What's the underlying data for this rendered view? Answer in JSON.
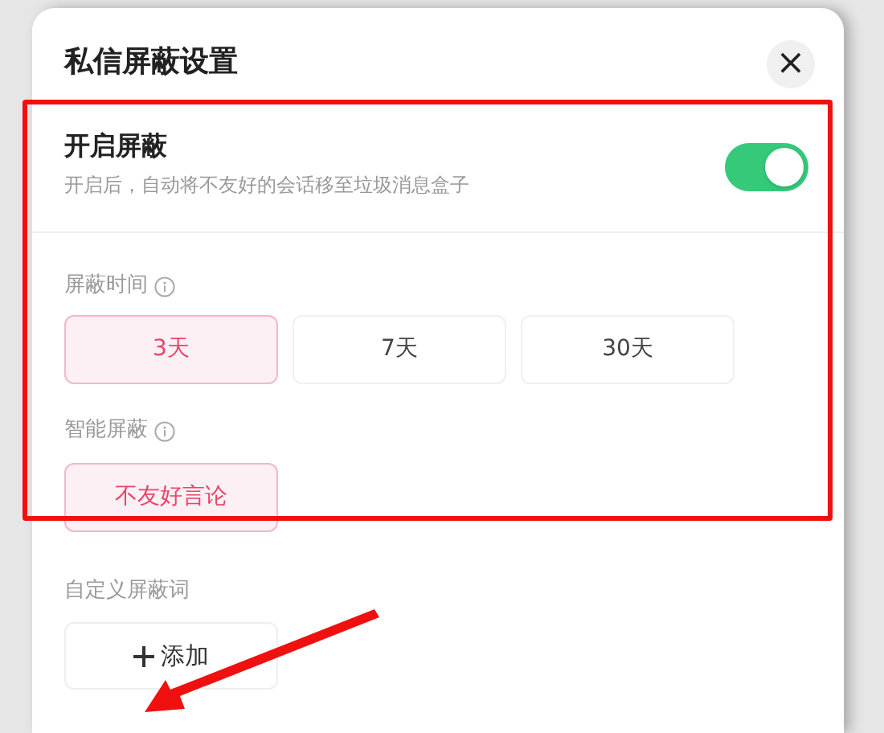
{
  "dialog": {
    "title": "私信屏蔽设置",
    "close_icon": "×"
  },
  "block_toggle": {
    "label": "开启屏蔽",
    "description": "开启后，自动将不友好的会话移至垃圾消息盒子",
    "on": true
  },
  "block_time": {
    "label": "屏蔽时间",
    "options": [
      {
        "label": "3天",
        "selected": true
      },
      {
        "label": "7天",
        "selected": false
      },
      {
        "label": "30天",
        "selected": false
      }
    ]
  },
  "smart_block": {
    "label": "智能屏蔽",
    "options": [
      {
        "label": "不友好言论",
        "selected": true
      }
    ]
  },
  "custom_words": {
    "label": "自定义屏蔽词",
    "add_button": "添加"
  }
}
